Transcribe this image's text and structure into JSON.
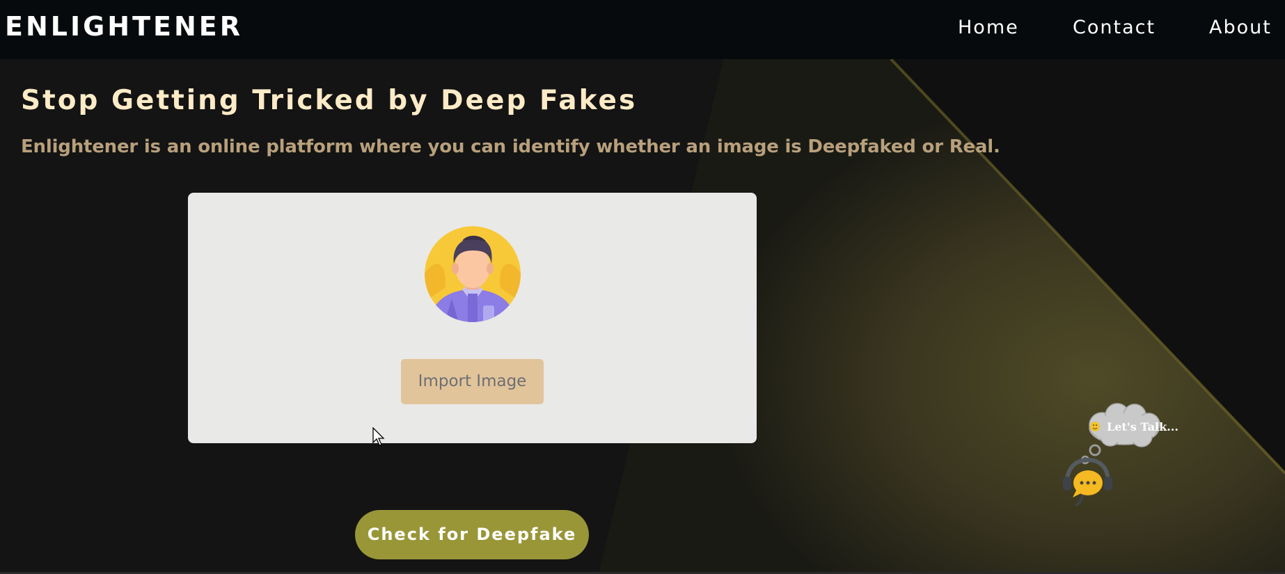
{
  "navbar": {
    "brand": "ENLIGHTENER",
    "links": [
      {
        "label": "Home"
      },
      {
        "label": "Contact"
      },
      {
        "label": "About"
      }
    ]
  },
  "hero": {
    "title": "Stop Getting Tricked by Deep Fakes",
    "subtitle": "Enlightener is an online platform where you can identify whether an image is Deepfaked or Real."
  },
  "upload_card": {
    "avatar_icon": "user-avatar-icon",
    "import_button_label": "Import Image"
  },
  "check_button_label": "Check for Deepfake",
  "chat_widget": {
    "cloud_text": "Let's Talk...",
    "icon": "chat-support-icon"
  },
  "colors": {
    "navbar_bg": "#070a0c",
    "page_bg": "#141414",
    "accent_olive": "#999638",
    "title_cream": "#fdebc7",
    "subtitle_tan": "#b8a07c",
    "card_bg": "#e9e9e7",
    "import_button_bg": "#e2c49b"
  }
}
